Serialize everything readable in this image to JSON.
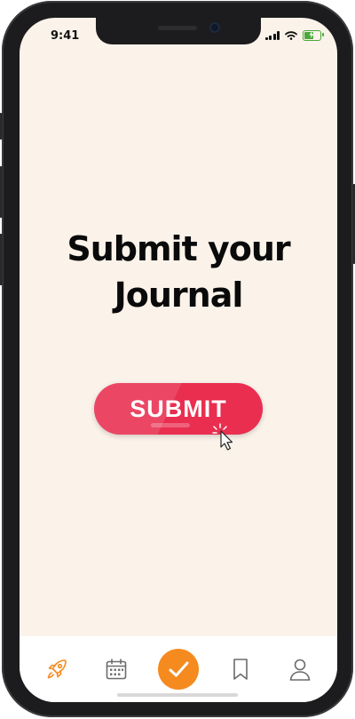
{
  "status_bar": {
    "time": "9:41"
  },
  "main": {
    "title_line1": "Submit your",
    "title_line2": "Journal",
    "submit_label": "SUBMIT"
  },
  "tab_bar": {
    "items": [
      {
        "icon": "rocket-icon"
      },
      {
        "icon": "calendar-icon"
      },
      {
        "icon": "checkmark-icon",
        "active": true
      },
      {
        "icon": "bookmark-icon"
      },
      {
        "icon": "profile-icon"
      }
    ]
  },
  "colors": {
    "background": "#fbf3ea",
    "submit_button": "#e92e50",
    "accent": "#f58a1f",
    "tab_icon": "#6b6b6b"
  }
}
